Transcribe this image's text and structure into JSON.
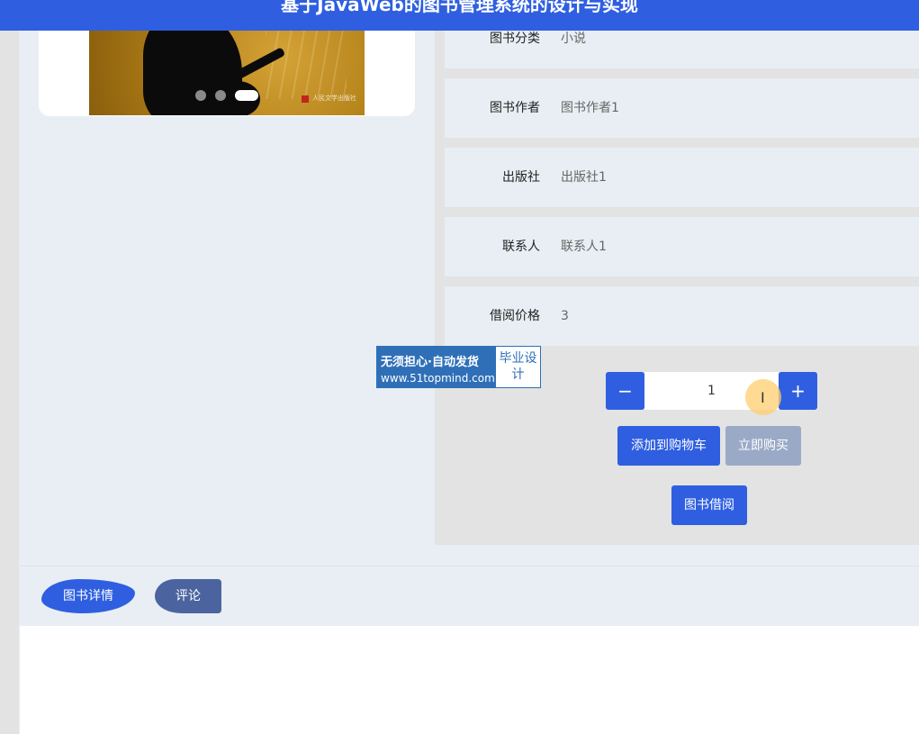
{
  "header": {
    "title": "基于JavaWeb的图书管理系统的设计与实现"
  },
  "carousel": {
    "publisher_mark": "人民文学出版社",
    "slide_count": 3,
    "active_slide": 3
  },
  "details": [
    {
      "label": "图书分类",
      "value": "小说"
    },
    {
      "label": "图书作者",
      "value": "图书作者1"
    },
    {
      "label": "出版社",
      "value": "出版社1"
    },
    {
      "label": "联系人",
      "value": "联系人1"
    },
    {
      "label": "借阅价格",
      "value": "3"
    }
  ],
  "quantity": {
    "minus": "−",
    "value": "1",
    "plus": "+"
  },
  "actions": {
    "add_to_cart": "添加到购物车",
    "buy_now": "立即购买",
    "borrow": "图书借阅"
  },
  "watermark": {
    "line1": "无须担心·自动发货",
    "line2": "www.51topmind.com",
    "badge": "毕业设计"
  },
  "tabs": [
    {
      "label": "图书详情"
    },
    {
      "label": "评论"
    }
  ],
  "colors": {
    "primary": "#2f5fe0",
    "disabled": "#9aaac6",
    "panel": "#e8eef3"
  }
}
